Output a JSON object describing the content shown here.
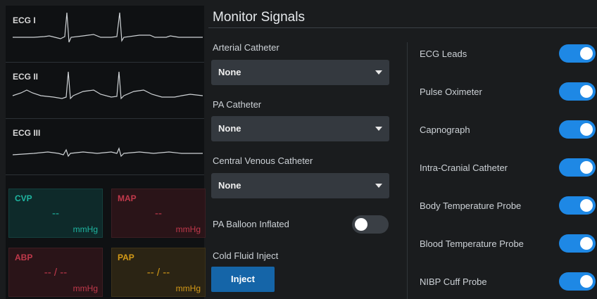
{
  "ecg": [
    {
      "label": "ECG I"
    },
    {
      "label": "ECG II"
    },
    {
      "label": "ECG III"
    }
  ],
  "tiles": {
    "cvp": {
      "label": "CVP",
      "value": "--",
      "unit": "mmHg",
      "color": "#1fb5a0",
      "bg": "#0e2a2a"
    },
    "map": {
      "label": "MAP",
      "value": "--",
      "unit": "mmHg",
      "color": "#c0394b",
      "bg": "#2a1418"
    },
    "abp": {
      "label": "ABP",
      "value": "-- / --",
      "unit": "mmHg",
      "color": "#c0394b",
      "bg": "#2a1418"
    },
    "pap": {
      "label": "PAP",
      "value": "-- / --",
      "unit": "mmHg",
      "color": "#d49a17",
      "bg": "#2b2414"
    }
  },
  "panel": {
    "title": "Monitor Signals",
    "arterial_label": "Arterial Catheter",
    "arterial_value": "None",
    "pa_label": "PA Catheter",
    "pa_value": "None",
    "cvc_label": "Central Venous Catheter",
    "cvc_value": "None",
    "balloon_label": "PA Balloon Inflated",
    "balloon_on": false,
    "cold_label": "Cold Fluid Inject",
    "inject_label": "Inject"
  },
  "signals": [
    {
      "label": "ECG Leads",
      "on": true
    },
    {
      "label": "Pulse Oximeter",
      "on": true
    },
    {
      "label": "Capnograph",
      "on": true
    },
    {
      "label": "Intra-Cranial Catheter",
      "on": true
    },
    {
      "label": "Body Temperature Probe",
      "on": true
    },
    {
      "label": "Blood Temperature Probe",
      "on": true
    },
    {
      "label": "NIBP Cuff Probe",
      "on": true
    }
  ]
}
